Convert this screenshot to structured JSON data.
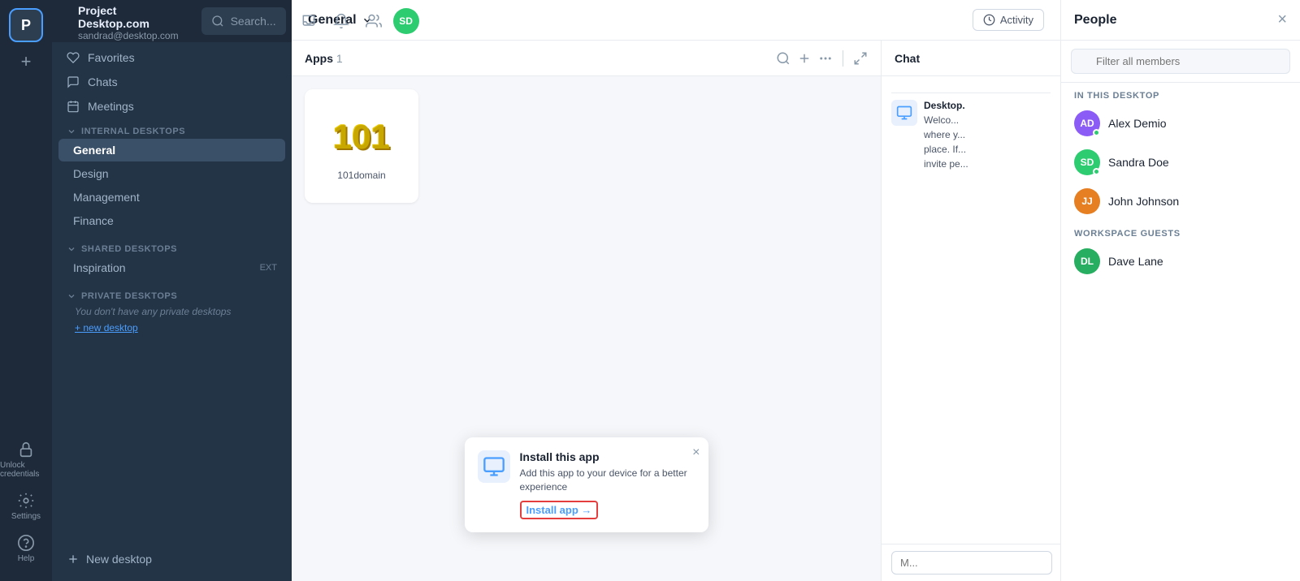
{
  "app": {
    "workspace_initial": "P",
    "name": "Project Desktop.com",
    "email": "sandrad@desktop.com"
  },
  "topbar": {
    "search_placeholder": "Search...",
    "user_initials": "SD"
  },
  "sidebar": {
    "favorites_label": "Favorites",
    "chats_label": "Chats",
    "meetings_label": "Meetings",
    "internal_desktops_label": "INTERNAL DESKTOPS",
    "shared_desktops_label": "SHARED DESKTOPS",
    "private_desktops_label": "PRIVATE DESKTOPS",
    "internal_items": [
      {
        "name": "General",
        "active": true
      },
      {
        "name": "Design",
        "active": false
      },
      {
        "name": "Management",
        "active": false
      },
      {
        "name": "Finance",
        "active": false
      }
    ],
    "shared_items": [
      {
        "name": "Inspiration",
        "badge": "EXT"
      }
    ],
    "private_no_desktops_msg": "You don't have any private desktops",
    "new_desktop_label": "New desktop",
    "unlock_credentials_label": "Unlock credentials",
    "settings_label": "Settings",
    "help_label": "Help"
  },
  "channel": {
    "name": "General",
    "activity_label": "Activity"
  },
  "apps": {
    "title": "Apps",
    "count": "1",
    "items": [
      {
        "name": "101domain",
        "icon": "101"
      }
    ]
  },
  "chat": {
    "header": "Chat",
    "desktop_sender": "Desktop.",
    "message_text": "Welco... where y... place. If... invite pe...",
    "input_placeholder": "M..."
  },
  "people": {
    "title": "People",
    "filter_placeholder": "Filter all members",
    "in_this_desktop_label": "IN THIS DESKTOP",
    "workspace_guests_label": "WORKSPACE GUESTS",
    "members": [
      {
        "name": "Alex Demio",
        "initials": "AD",
        "color": "#8b5cf6",
        "online": true
      },
      {
        "name": "Sandra Doe",
        "initials": "SD",
        "color": "#2ecc71",
        "online": true
      },
      {
        "name": "John Johnson",
        "initials": "JJ",
        "color": "#e67e22",
        "online": false
      }
    ],
    "guests": [
      {
        "name": "Dave Lane",
        "initials": "DL",
        "color": "#27ae60",
        "online": false
      }
    ]
  },
  "install_popup": {
    "title": "Install this app",
    "description": "Add this app to your device for a better experience",
    "install_label": "Install app →"
  }
}
